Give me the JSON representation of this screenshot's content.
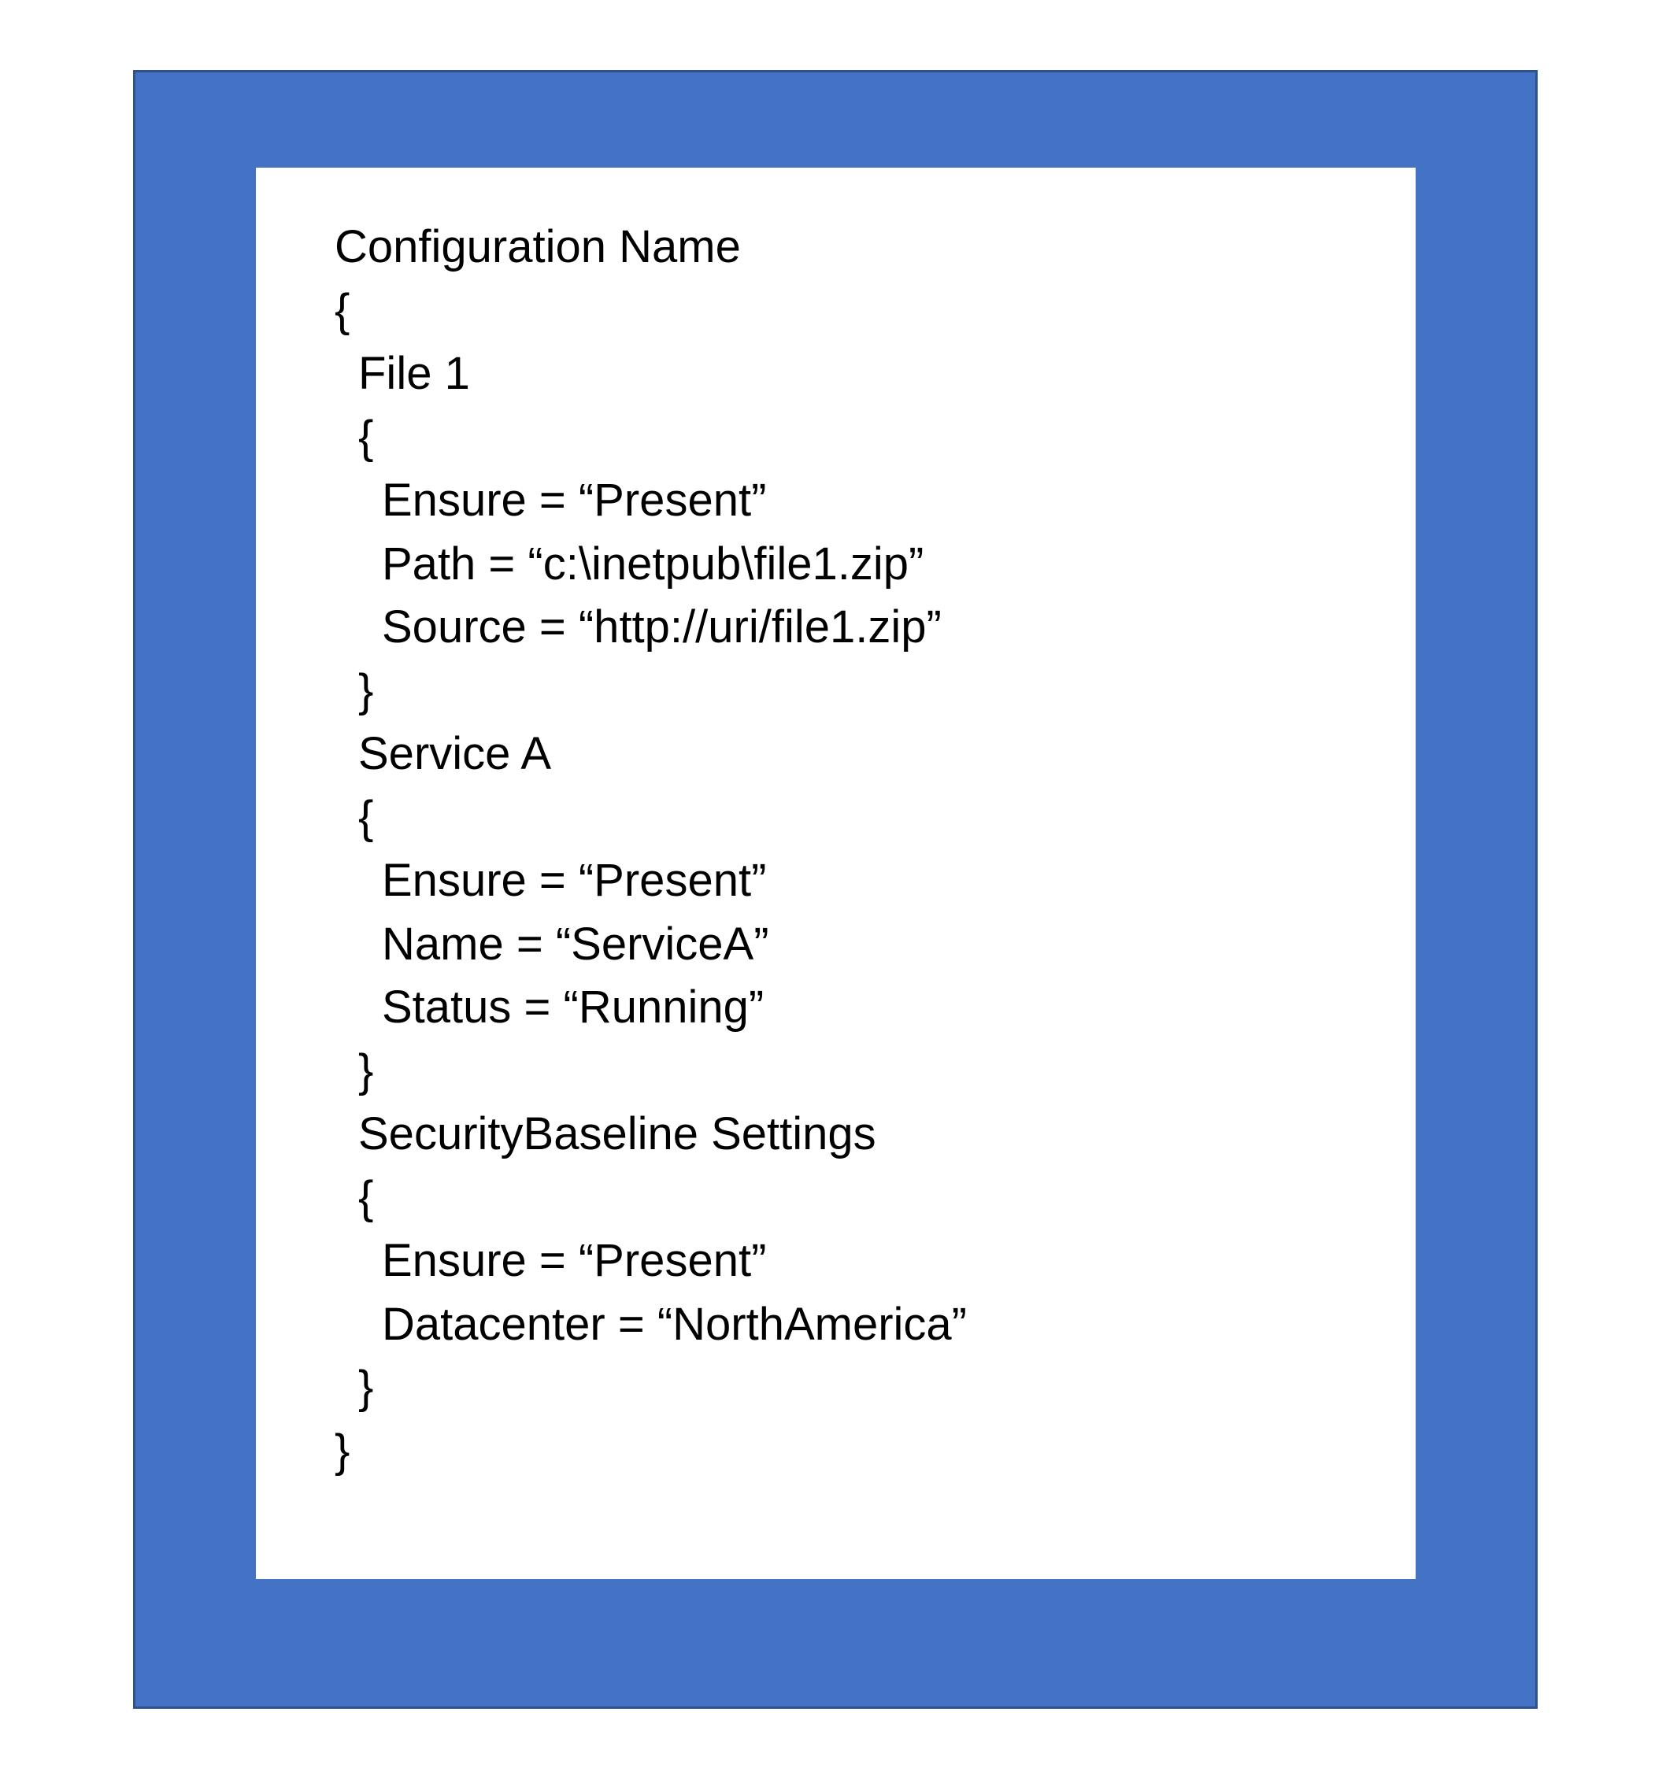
{
  "colors": {
    "frame": "#4472C4",
    "frame_border": "#2F528F",
    "inner": "#FFFFFF",
    "text": "#000000"
  },
  "config": {
    "title": "Configuration Name",
    "open_brace": "{",
    "close_brace": "}",
    "resources": [
      {
        "name": "File 1",
        "open_brace": "{",
        "properties": [
          "Ensure = “Present”",
          "Path = “c:\\inetpub\\file1.zip”",
          "Source = “http://uri/file1.zip”"
        ],
        "close_brace": "}"
      },
      {
        "name": "Service A",
        "open_brace": "{",
        "properties": [
          "Ensure = “Present”",
          "Name = “ServiceA”",
          "Status = “Running”"
        ],
        "close_brace": "}"
      },
      {
        "name": "SecurityBaseline Settings",
        "open_brace": "{",
        "properties": [
          "Ensure = “Present”",
          "Datacenter = “NorthAmerica”"
        ],
        "close_brace": "}"
      }
    ]
  }
}
